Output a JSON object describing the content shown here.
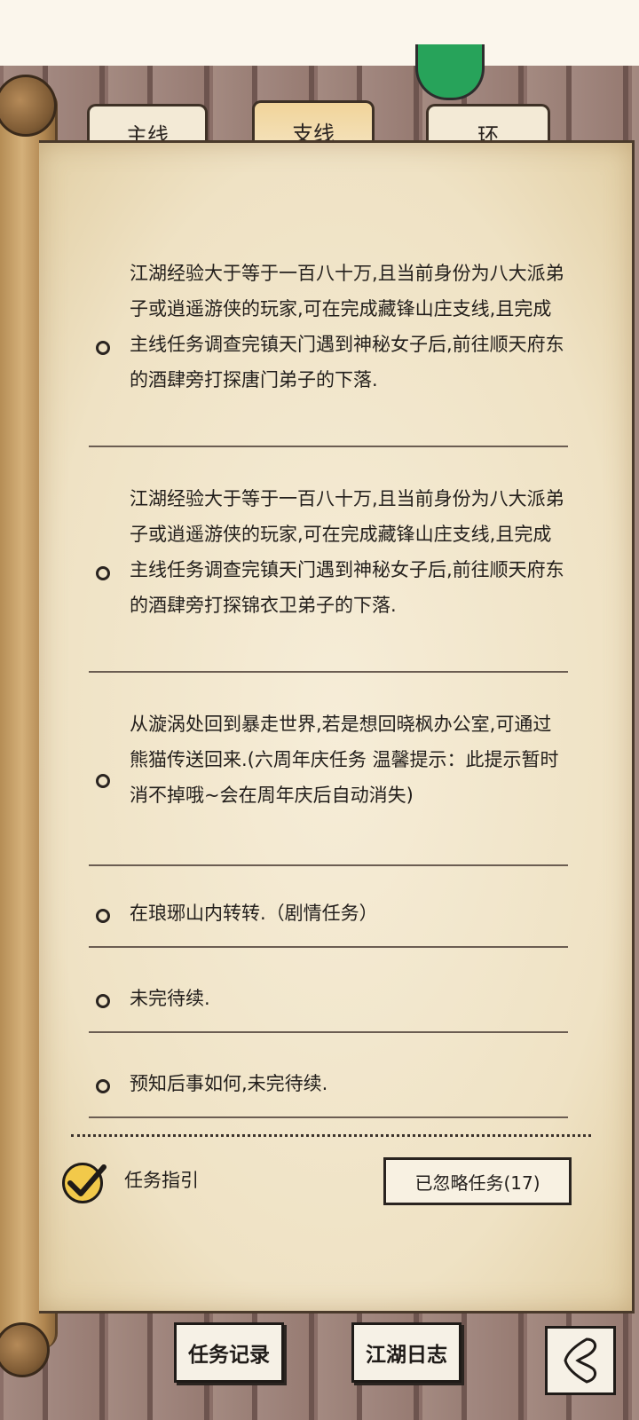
{
  "tabs": [
    {
      "label": "主线"
    },
    {
      "label": "支线"
    },
    {
      "label": "环"
    }
  ],
  "quests": [
    {
      "text": "江湖经验大于等于一百八十万,且当前身份为八大派弟子或逍遥游侠的玩家,可在完成藏锋山庄支线,且完成主线任务调查完镇天门遇到神秘女子后,前往顺天府东的酒肆旁打探唐门弟子的下落."
    },
    {
      "text": "江湖经验大于等于一百八十万,且当前身份为八大派弟子或逍遥游侠的玩家,可在完成藏锋山庄支线,且完成主线任务调查完镇天门遇到神秘女子后,前往顺天府东的酒肆旁打探锦衣卫弟子的下落."
    },
    {
      "text": "从漩涡处回到暴走世界,若是想回晓枫办公室,可通过熊猫传送回来.(六周年庆任务 温馨提示：此提示暂时消不掉哦~会在周年庆后自动消失)"
    },
    {
      "text": "在琅琊山内转转.（剧情任务）"
    },
    {
      "text": "未完待续."
    },
    {
      "text": "预知后事如何,未完待续."
    }
  ],
  "footer": {
    "guide_label": "任务指引",
    "ignored_label": "已忽略任务(17)"
  },
  "bottom": {
    "record_label": "任务记录",
    "journal_label": "江湖日志"
  }
}
